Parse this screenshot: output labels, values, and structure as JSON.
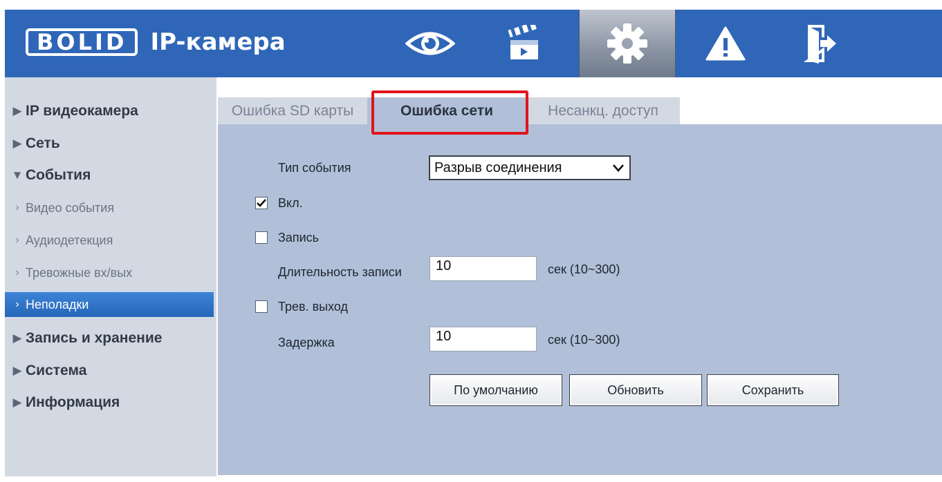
{
  "header": {
    "logo_text": "BOLID",
    "app_title": "IP-камера",
    "nav": [
      "live-view",
      "playback",
      "settings",
      "alarm",
      "logout"
    ],
    "active_nav": "settings",
    "colors": {
      "bar": "#2f66b8",
      "active": "#8d97a6"
    }
  },
  "sidebar": {
    "items": [
      {
        "label": "IP видеокамера",
        "level": "top",
        "expanded": false
      },
      {
        "label": "Сеть",
        "level": "top",
        "expanded": false
      },
      {
        "label": "События",
        "level": "top",
        "expanded": true
      },
      {
        "label": "Видео события",
        "level": "sub"
      },
      {
        "label": "Аудиодетекция",
        "level": "sub"
      },
      {
        "label": "Тревожные вх/вых",
        "level": "sub"
      },
      {
        "label": "Неполадки",
        "level": "sub",
        "selected": true
      },
      {
        "label": "Запись и хранение",
        "level": "top",
        "expanded": false
      },
      {
        "label": "Система",
        "level": "top",
        "expanded": false
      },
      {
        "label": "Информация",
        "level": "top",
        "expanded": false
      }
    ]
  },
  "tabs": [
    {
      "label": "Ошибка SD карты",
      "active": false
    },
    {
      "label": "Ошибка сети",
      "active": true
    },
    {
      "label": "Несанкц. доступ",
      "active": false
    }
  ],
  "form": {
    "event_type_label": "Тип события",
    "event_type_value": "Разрыв соединения",
    "enable_label": "Вкл.",
    "enable_checked": true,
    "record_label": "Запись",
    "record_checked": false,
    "record_duration_label": "Длительность записи",
    "record_duration_value": "10",
    "record_duration_unit": "сек (10~300)",
    "alarm_out_label": "Трев. выход",
    "alarm_out_checked": false,
    "delay_label": "Задержка",
    "delay_value": "10",
    "delay_unit": "сек (10~300)"
  },
  "buttons": {
    "default": "По умолчанию",
    "refresh": "Обновить",
    "save": "Сохранить"
  },
  "highlight_color": "#e0141b"
}
